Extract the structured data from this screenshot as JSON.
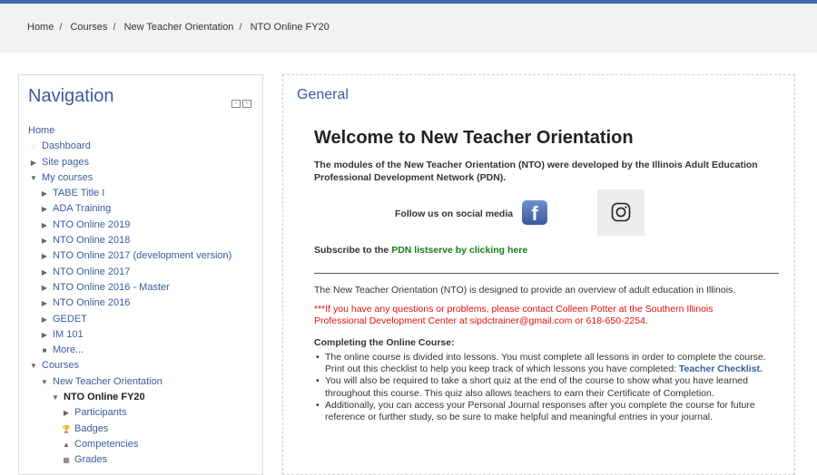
{
  "breadcrumb": [
    "Home",
    "Courses",
    "New Teacher Orientation",
    "NTO Online FY20"
  ],
  "navigation": {
    "title": "Navigation",
    "items": [
      {
        "label": "Home",
        "icon": "",
        "level": 0,
        "bold": false
      },
      {
        "label": "Dashboard",
        "icon": "dashboard-icon",
        "level": 0,
        "bold": false
      },
      {
        "label": "Site pages",
        "icon": "chevron-right-icon",
        "level": 0,
        "bold": false
      },
      {
        "label": "My courses",
        "icon": "chevron-down-icon",
        "level": 0,
        "bold": false
      },
      {
        "label": "TABE Title I",
        "icon": "chevron-right-icon",
        "level": 1,
        "bold": false
      },
      {
        "label": "ADA Training",
        "icon": "chevron-right-icon",
        "level": 1,
        "bold": false
      },
      {
        "label": "NTO Online 2019",
        "icon": "chevron-right-icon",
        "level": 1,
        "bold": false
      },
      {
        "label": "NTO Online 2018",
        "icon": "chevron-right-icon",
        "level": 1,
        "bold": false
      },
      {
        "label": "NTO Online 2017 (development version)",
        "icon": "chevron-right-icon",
        "level": 1,
        "bold": false
      },
      {
        "label": "NTO Online 2017",
        "icon": "chevron-right-icon",
        "level": 1,
        "bold": false
      },
      {
        "label": "NTO Online 2016 - Master",
        "icon": "chevron-right-icon",
        "level": 1,
        "bold": false
      },
      {
        "label": "NTO Online 2016",
        "icon": "chevron-right-icon",
        "level": 1,
        "bold": false
      },
      {
        "label": "GEDET",
        "icon": "chevron-right-icon",
        "level": 1,
        "bold": false
      },
      {
        "label": "IM 101",
        "icon": "chevron-right-icon",
        "level": 1,
        "bold": false
      },
      {
        "label": "More...",
        "icon": "square-bullet-icon",
        "level": 1,
        "bold": false
      },
      {
        "label": "Courses",
        "icon": "chevron-down-icon",
        "level": 0,
        "bold": false
      },
      {
        "label": "New Teacher Orientation",
        "icon": "chevron-down-icon",
        "level": 1,
        "bold": false
      },
      {
        "label": "NTO Online FY20",
        "icon": "chevron-down-icon",
        "level": 2,
        "bold": true
      },
      {
        "label": "Participants",
        "icon": "chevron-right-icon",
        "level": 3,
        "bold": false
      },
      {
        "label": "Badges",
        "icon": "trophy-icon",
        "level": 3,
        "bold": false
      },
      {
        "label": "Competencies",
        "icon": "competencies-icon",
        "level": 3,
        "bold": false
      },
      {
        "label": "Grades",
        "icon": "grades-icon",
        "level": 3,
        "bold": false
      }
    ]
  },
  "main": {
    "section_title": "General",
    "welcome": "Welcome to New Teacher Orientation",
    "intro": "The modules of the New Teacher Orientation (NTO) were developed by the Illinois Adult Education Professional Development Network (PDN).",
    "follow": "Follow us on social media",
    "facebook_glyph": "f",
    "subscribe_prefix": "Subscribe to the ",
    "subscribe_link": "PDN listserve by clicking here",
    "overview": "The New Teacher Orientation (NTO) is designed to provide an overview of adult education in Illinois.",
    "contact": "***If you have any questions or problems, please contact Colleen Potter at the Southern Illinois Professional Development Center at sipdctrainer@gmail.com or 618-650-2254.",
    "completing_heading": "Completing the Online Course:",
    "bullet1_text": "The online course is divided into lessons. You must complete all lessons in order to complete the course. Print out this checklist to help you keep track of which lessons you have completed: ",
    "bullet1_link": "Teacher Checklist.",
    "bullet2_text": "You will also be required to take a short quiz at the end of the course to show what you have learned throughout this course.  This quiz also allows teachers to earn their Certificate of Completion.",
    "bullet3_text": "Additionally, you can access your Personal Journal responses after you complete the course for future reference or further study, so be sure to make helpful and meaningful entries in your journal."
  },
  "colors": {
    "accent": "#3a5b9a",
    "link_green": "#1a7a1a",
    "alert_red": "#e01010",
    "top_bar": "#4169a8"
  }
}
